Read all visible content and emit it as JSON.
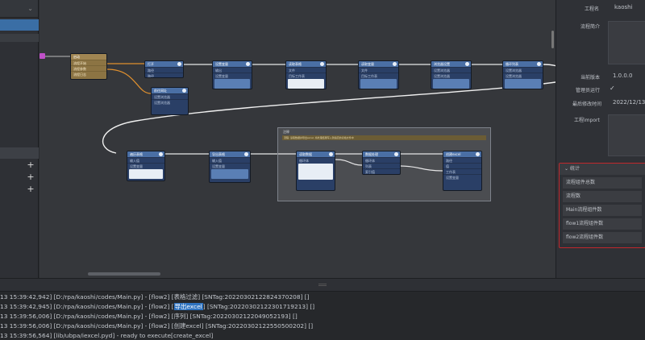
{
  "left_panel": {
    "plus_buttons": [
      "+",
      "+",
      "+"
    ]
  },
  "canvas": {
    "nodes": [
      {
        "title": "启动",
        "rows": [
          "流程开始",
          "流程参数",
          "流程日志"
        ]
      },
      {
        "title": "打开",
        "rows": [
          "路径",
          "路径"
        ]
      },
      {
        "title": "设置变量",
        "rows": [
          "输出",
          "设置变量",
          "变量"
        ]
      },
      {
        "title": "读取表格",
        "rows": [
          "文件",
          "目标工作表"
        ]
      },
      {
        "title": "读取变量",
        "rows": [
          "文件",
          "目标工作表"
        ]
      },
      {
        "title": "浏览器设置",
        "rows": [
          "设置浏览器",
          "设置浏览器"
        ]
      },
      {
        "title": "循环列表",
        "rows": [
          "设置浏览器",
          "设置浏览器"
        ]
      },
      {
        "title": "前往网址",
        "rows": [
          "设置浏览器",
          "设置浏览器"
        ]
      },
      {
        "title": "遍历表格",
        "rows": [
          "输入值",
          "设置变量"
        ]
      },
      {
        "title": "导出表格",
        "rows": [
          "输入值",
          "设置变量"
        ]
      },
      {
        "title": "读取数据",
        "rows": [
          "循环体"
        ]
      },
      {
        "title": "数据处理",
        "rows": [
          "循环体",
          "列表",
          "索引值"
        ]
      },
      {
        "title": "创建excel",
        "rows": [
          "路径",
          "值",
          "工作表",
          "设置变量"
        ]
      }
    ],
    "group": {
      "title": "注释",
      "note": "流程: 读取数据并导出excel, 将处理结果写入到指定的表格文件中"
    }
  },
  "properties": {
    "project_label": "工程名",
    "project_value": "kaoshi",
    "intro_label": "流程简介",
    "version_label": "当前版本",
    "version_value": "1.0.0.0",
    "admin_label": "管理员运行",
    "admin_checked": "✓",
    "modified_label": "最后修改时间",
    "modified_value": "2022/12/13",
    "import_label": "工程import"
  },
  "stats": {
    "header": "统计",
    "chevron": "⌄",
    "rows": [
      "流程组件总数",
      "流程数",
      "Main流程组件数",
      "flow1流程组件数",
      "flow2流程组件数"
    ]
  },
  "log": {
    "lines": [
      {
        "pre": "13 15:39:42,942] [D:/rpa/kaoshi/codes/Main.py] - [flow2] [",
        "mid": "表格过滤",
        "post": "] [SNTag:20220302122824370208] []",
        "hl": false
      },
      {
        "pre": "13 15:39:42,945] [D:/rpa/kaoshi/codes/Main.py] - [flow2] [",
        "mid": "导出excel",
        "post": "] [SNTag:20220302122301719213] []",
        "hl": true
      },
      {
        "pre": "13 15:39:56,006] [D:/rpa/kaoshi/codes/Main.py] - [flow2] [",
        "mid": "序列",
        "post": "] [SNTag:20220302122049052193] []",
        "hl": false
      },
      {
        "pre": "13 15:39:56,006] [D:/rpa/kaoshi/codes/Main.py] - [flow2] [",
        "mid": "创建excel",
        "post": "] [SNTag:20220302122550500202] []",
        "hl": false
      },
      {
        "pre": "13 15:39:56,564] [lib/ubpa/iexcel.pyd] - ready to execute[create_excel]",
        "mid": "",
        "post": "",
        "hl": false
      }
    ]
  },
  "colors": {
    "accent": "#3a6ea5",
    "highlight": "#2f73c0",
    "stats_border": "#c0282c",
    "node_header": "#4a6fa5",
    "node_body": "#2a3f66",
    "start_node": "#8c7443"
  }
}
